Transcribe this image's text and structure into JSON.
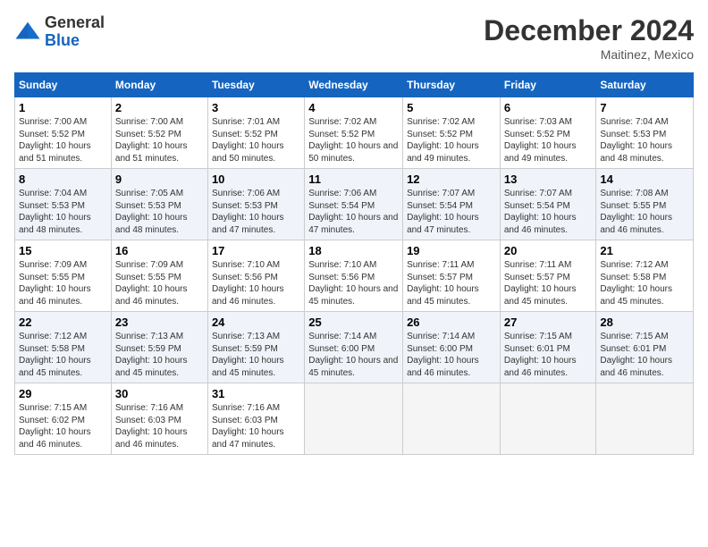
{
  "logo": {
    "general": "General",
    "blue": "Blue"
  },
  "title": "December 2024",
  "location": "Maitinez, Mexico",
  "days_of_week": [
    "Sunday",
    "Monday",
    "Tuesday",
    "Wednesday",
    "Thursday",
    "Friday",
    "Saturday"
  ],
  "weeks": [
    [
      {
        "day": 1,
        "sunrise": "7:00 AM",
        "sunset": "5:52 PM",
        "daylight": "10 hours and 51 minutes."
      },
      {
        "day": 2,
        "sunrise": "7:00 AM",
        "sunset": "5:52 PM",
        "daylight": "10 hours and 51 minutes."
      },
      {
        "day": 3,
        "sunrise": "7:01 AM",
        "sunset": "5:52 PM",
        "daylight": "10 hours and 50 minutes."
      },
      {
        "day": 4,
        "sunrise": "7:02 AM",
        "sunset": "5:52 PM",
        "daylight": "10 hours and 50 minutes."
      },
      {
        "day": 5,
        "sunrise": "7:02 AM",
        "sunset": "5:52 PM",
        "daylight": "10 hours and 49 minutes."
      },
      {
        "day": 6,
        "sunrise": "7:03 AM",
        "sunset": "5:52 PM",
        "daylight": "10 hours and 49 minutes."
      },
      {
        "day": 7,
        "sunrise": "7:04 AM",
        "sunset": "5:53 PM",
        "daylight": "10 hours and 48 minutes."
      }
    ],
    [
      {
        "day": 8,
        "sunrise": "7:04 AM",
        "sunset": "5:53 PM",
        "daylight": "10 hours and 48 minutes."
      },
      {
        "day": 9,
        "sunrise": "7:05 AM",
        "sunset": "5:53 PM",
        "daylight": "10 hours and 48 minutes."
      },
      {
        "day": 10,
        "sunrise": "7:06 AM",
        "sunset": "5:53 PM",
        "daylight": "10 hours and 47 minutes."
      },
      {
        "day": 11,
        "sunrise": "7:06 AM",
        "sunset": "5:54 PM",
        "daylight": "10 hours and 47 minutes."
      },
      {
        "day": 12,
        "sunrise": "7:07 AM",
        "sunset": "5:54 PM",
        "daylight": "10 hours and 47 minutes."
      },
      {
        "day": 13,
        "sunrise": "7:07 AM",
        "sunset": "5:54 PM",
        "daylight": "10 hours and 46 minutes."
      },
      {
        "day": 14,
        "sunrise": "7:08 AM",
        "sunset": "5:55 PM",
        "daylight": "10 hours and 46 minutes."
      }
    ],
    [
      {
        "day": 15,
        "sunrise": "7:09 AM",
        "sunset": "5:55 PM",
        "daylight": "10 hours and 46 minutes."
      },
      {
        "day": 16,
        "sunrise": "7:09 AM",
        "sunset": "5:55 PM",
        "daylight": "10 hours and 46 minutes."
      },
      {
        "day": 17,
        "sunrise": "7:10 AM",
        "sunset": "5:56 PM",
        "daylight": "10 hours and 46 minutes."
      },
      {
        "day": 18,
        "sunrise": "7:10 AM",
        "sunset": "5:56 PM",
        "daylight": "10 hours and 45 minutes."
      },
      {
        "day": 19,
        "sunrise": "7:11 AM",
        "sunset": "5:57 PM",
        "daylight": "10 hours and 45 minutes."
      },
      {
        "day": 20,
        "sunrise": "7:11 AM",
        "sunset": "5:57 PM",
        "daylight": "10 hours and 45 minutes."
      },
      {
        "day": 21,
        "sunrise": "7:12 AM",
        "sunset": "5:58 PM",
        "daylight": "10 hours and 45 minutes."
      }
    ],
    [
      {
        "day": 22,
        "sunrise": "7:12 AM",
        "sunset": "5:58 PM",
        "daylight": "10 hours and 45 minutes."
      },
      {
        "day": 23,
        "sunrise": "7:13 AM",
        "sunset": "5:59 PM",
        "daylight": "10 hours and 45 minutes."
      },
      {
        "day": 24,
        "sunrise": "7:13 AM",
        "sunset": "5:59 PM",
        "daylight": "10 hours and 45 minutes."
      },
      {
        "day": 25,
        "sunrise": "7:14 AM",
        "sunset": "6:00 PM",
        "daylight": "10 hours and 45 minutes."
      },
      {
        "day": 26,
        "sunrise": "7:14 AM",
        "sunset": "6:00 PM",
        "daylight": "10 hours and 46 minutes."
      },
      {
        "day": 27,
        "sunrise": "7:15 AM",
        "sunset": "6:01 PM",
        "daylight": "10 hours and 46 minutes."
      },
      {
        "day": 28,
        "sunrise": "7:15 AM",
        "sunset": "6:01 PM",
        "daylight": "10 hours and 46 minutes."
      }
    ],
    [
      {
        "day": 29,
        "sunrise": "7:15 AM",
        "sunset": "6:02 PM",
        "daylight": "10 hours and 46 minutes."
      },
      {
        "day": 30,
        "sunrise": "7:16 AM",
        "sunset": "6:03 PM",
        "daylight": "10 hours and 46 minutes."
      },
      {
        "day": 31,
        "sunrise": "7:16 AM",
        "sunset": "6:03 PM",
        "daylight": "10 hours and 47 minutes."
      },
      null,
      null,
      null,
      null
    ]
  ]
}
